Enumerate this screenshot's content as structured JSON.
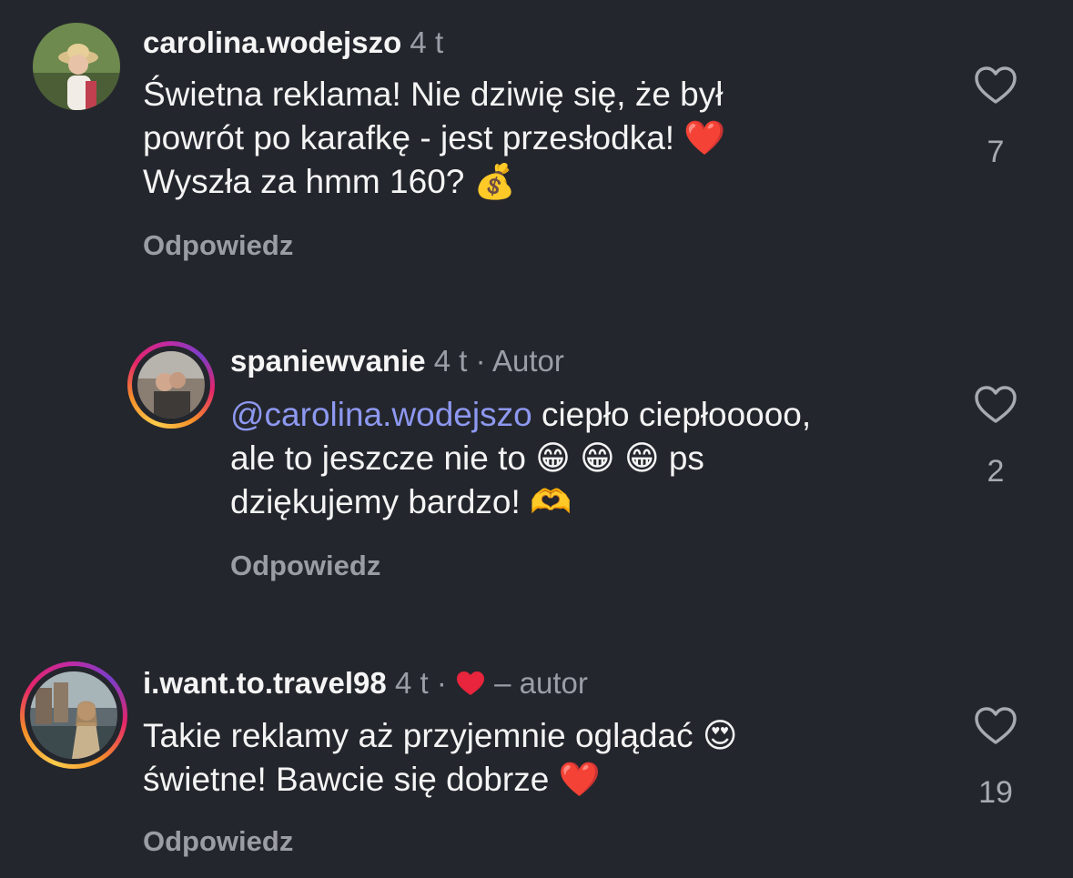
{
  "comments": [
    {
      "username": "carolina.wodejszo",
      "time": "4 t",
      "lines": [
        "Świetna reklama! Nie dziwię się, że był",
        "powrót po karafkę - jest  przesłodka!",
        "Wyszła za hmm 160?"
      ],
      "emojis": [
        "❤️",
        "💰"
      ],
      "reply_label": "Odpowiedz",
      "like_count": "7",
      "like_icon": "heart-outline-icon"
    },
    {
      "username": "spaniewvanie",
      "time": "4 t",
      "separator": "·",
      "author_tag": "Autor",
      "mention": "@carolina.wodejszo",
      "lines": [
        " ciepło ciepłooooo,",
        "ale to jeszcze nie to",
        "ps",
        "dziękujemy bardzo!"
      ],
      "emojis": [
        "😁",
        "😁",
        "😁",
        "🫶"
      ],
      "reply_label": "Odpowiedz",
      "like_count": "2",
      "like_icon": "heart-outline-icon"
    },
    {
      "username": "i.want.to.travel98",
      "time": "4 t",
      "separator": "·",
      "liked_by": "– autor",
      "lines": [
        "Takie reklamy aż przyjemnie oglądać",
        "świetne! Bawcie się dobrze"
      ],
      "emojis": [
        "😍",
        "❤️"
      ],
      "reply_label": "Odpowiedz",
      "like_count": "19",
      "like_icon": "heart-outline-icon"
    }
  ],
  "colors": {
    "background": "#24262d",
    "mention": "#8d98f0",
    "muted": "#9b9ea6",
    "heart": "#e8253c"
  }
}
